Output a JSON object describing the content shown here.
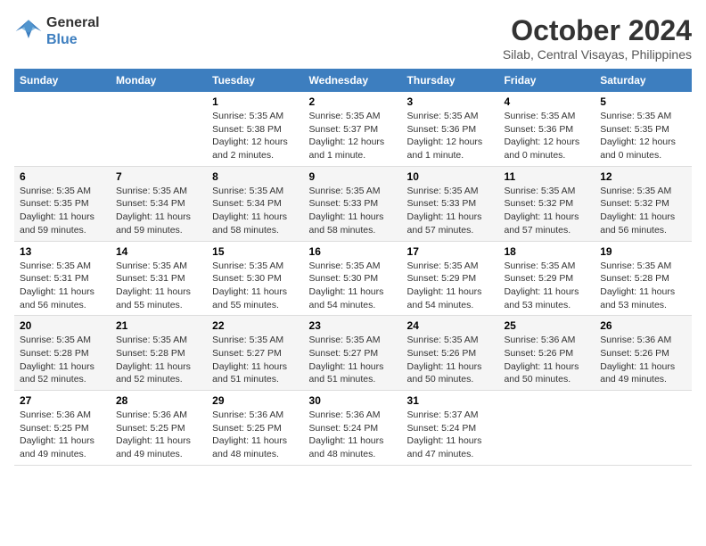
{
  "logo": {
    "line1": "General",
    "line2": "Blue"
  },
  "title": "October 2024",
  "location": "Silab, Central Visayas, Philippines",
  "weekdays": [
    "Sunday",
    "Monday",
    "Tuesday",
    "Wednesday",
    "Thursday",
    "Friday",
    "Saturday"
  ],
  "weeks": [
    [
      {
        "day": "",
        "sunrise": "",
        "sunset": "",
        "daylight": ""
      },
      {
        "day": "",
        "sunrise": "",
        "sunset": "",
        "daylight": ""
      },
      {
        "day": "1",
        "sunrise": "Sunrise: 5:35 AM",
        "sunset": "Sunset: 5:38 PM",
        "daylight": "Daylight: 12 hours and 2 minutes."
      },
      {
        "day": "2",
        "sunrise": "Sunrise: 5:35 AM",
        "sunset": "Sunset: 5:37 PM",
        "daylight": "Daylight: 12 hours and 1 minute."
      },
      {
        "day": "3",
        "sunrise": "Sunrise: 5:35 AM",
        "sunset": "Sunset: 5:36 PM",
        "daylight": "Daylight: 12 hours and 1 minute."
      },
      {
        "day": "4",
        "sunrise": "Sunrise: 5:35 AM",
        "sunset": "Sunset: 5:36 PM",
        "daylight": "Daylight: 12 hours and 0 minutes."
      },
      {
        "day": "5",
        "sunrise": "Sunrise: 5:35 AM",
        "sunset": "Sunset: 5:35 PM",
        "daylight": "Daylight: 12 hours and 0 minutes."
      }
    ],
    [
      {
        "day": "6",
        "sunrise": "Sunrise: 5:35 AM",
        "sunset": "Sunset: 5:35 PM",
        "daylight": "Daylight: 11 hours and 59 minutes."
      },
      {
        "day": "7",
        "sunrise": "Sunrise: 5:35 AM",
        "sunset": "Sunset: 5:34 PM",
        "daylight": "Daylight: 11 hours and 59 minutes."
      },
      {
        "day": "8",
        "sunrise": "Sunrise: 5:35 AM",
        "sunset": "Sunset: 5:34 PM",
        "daylight": "Daylight: 11 hours and 58 minutes."
      },
      {
        "day": "9",
        "sunrise": "Sunrise: 5:35 AM",
        "sunset": "Sunset: 5:33 PM",
        "daylight": "Daylight: 11 hours and 58 minutes."
      },
      {
        "day": "10",
        "sunrise": "Sunrise: 5:35 AM",
        "sunset": "Sunset: 5:33 PM",
        "daylight": "Daylight: 11 hours and 57 minutes."
      },
      {
        "day": "11",
        "sunrise": "Sunrise: 5:35 AM",
        "sunset": "Sunset: 5:32 PM",
        "daylight": "Daylight: 11 hours and 57 minutes."
      },
      {
        "day": "12",
        "sunrise": "Sunrise: 5:35 AM",
        "sunset": "Sunset: 5:32 PM",
        "daylight": "Daylight: 11 hours and 56 minutes."
      }
    ],
    [
      {
        "day": "13",
        "sunrise": "Sunrise: 5:35 AM",
        "sunset": "Sunset: 5:31 PM",
        "daylight": "Daylight: 11 hours and 56 minutes."
      },
      {
        "day": "14",
        "sunrise": "Sunrise: 5:35 AM",
        "sunset": "Sunset: 5:31 PM",
        "daylight": "Daylight: 11 hours and 55 minutes."
      },
      {
        "day": "15",
        "sunrise": "Sunrise: 5:35 AM",
        "sunset": "Sunset: 5:30 PM",
        "daylight": "Daylight: 11 hours and 55 minutes."
      },
      {
        "day": "16",
        "sunrise": "Sunrise: 5:35 AM",
        "sunset": "Sunset: 5:30 PM",
        "daylight": "Daylight: 11 hours and 54 minutes."
      },
      {
        "day": "17",
        "sunrise": "Sunrise: 5:35 AM",
        "sunset": "Sunset: 5:29 PM",
        "daylight": "Daylight: 11 hours and 54 minutes."
      },
      {
        "day": "18",
        "sunrise": "Sunrise: 5:35 AM",
        "sunset": "Sunset: 5:29 PM",
        "daylight": "Daylight: 11 hours and 53 minutes."
      },
      {
        "day": "19",
        "sunrise": "Sunrise: 5:35 AM",
        "sunset": "Sunset: 5:28 PM",
        "daylight": "Daylight: 11 hours and 53 minutes."
      }
    ],
    [
      {
        "day": "20",
        "sunrise": "Sunrise: 5:35 AM",
        "sunset": "Sunset: 5:28 PM",
        "daylight": "Daylight: 11 hours and 52 minutes."
      },
      {
        "day": "21",
        "sunrise": "Sunrise: 5:35 AM",
        "sunset": "Sunset: 5:28 PM",
        "daylight": "Daylight: 11 hours and 52 minutes."
      },
      {
        "day": "22",
        "sunrise": "Sunrise: 5:35 AM",
        "sunset": "Sunset: 5:27 PM",
        "daylight": "Daylight: 11 hours and 51 minutes."
      },
      {
        "day": "23",
        "sunrise": "Sunrise: 5:35 AM",
        "sunset": "Sunset: 5:27 PM",
        "daylight": "Daylight: 11 hours and 51 minutes."
      },
      {
        "day": "24",
        "sunrise": "Sunrise: 5:35 AM",
        "sunset": "Sunset: 5:26 PM",
        "daylight": "Daylight: 11 hours and 50 minutes."
      },
      {
        "day": "25",
        "sunrise": "Sunrise: 5:36 AM",
        "sunset": "Sunset: 5:26 PM",
        "daylight": "Daylight: 11 hours and 50 minutes."
      },
      {
        "day": "26",
        "sunrise": "Sunrise: 5:36 AM",
        "sunset": "Sunset: 5:26 PM",
        "daylight": "Daylight: 11 hours and 49 minutes."
      }
    ],
    [
      {
        "day": "27",
        "sunrise": "Sunrise: 5:36 AM",
        "sunset": "Sunset: 5:25 PM",
        "daylight": "Daylight: 11 hours and 49 minutes."
      },
      {
        "day": "28",
        "sunrise": "Sunrise: 5:36 AM",
        "sunset": "Sunset: 5:25 PM",
        "daylight": "Daylight: 11 hours and 49 minutes."
      },
      {
        "day": "29",
        "sunrise": "Sunrise: 5:36 AM",
        "sunset": "Sunset: 5:25 PM",
        "daylight": "Daylight: 11 hours and 48 minutes."
      },
      {
        "day": "30",
        "sunrise": "Sunrise: 5:36 AM",
        "sunset": "Sunset: 5:24 PM",
        "daylight": "Daylight: 11 hours and 48 minutes."
      },
      {
        "day": "31",
        "sunrise": "Sunrise: 5:37 AM",
        "sunset": "Sunset: 5:24 PM",
        "daylight": "Daylight: 11 hours and 47 minutes."
      },
      {
        "day": "",
        "sunrise": "",
        "sunset": "",
        "daylight": ""
      },
      {
        "day": "",
        "sunrise": "",
        "sunset": "",
        "daylight": ""
      }
    ]
  ]
}
